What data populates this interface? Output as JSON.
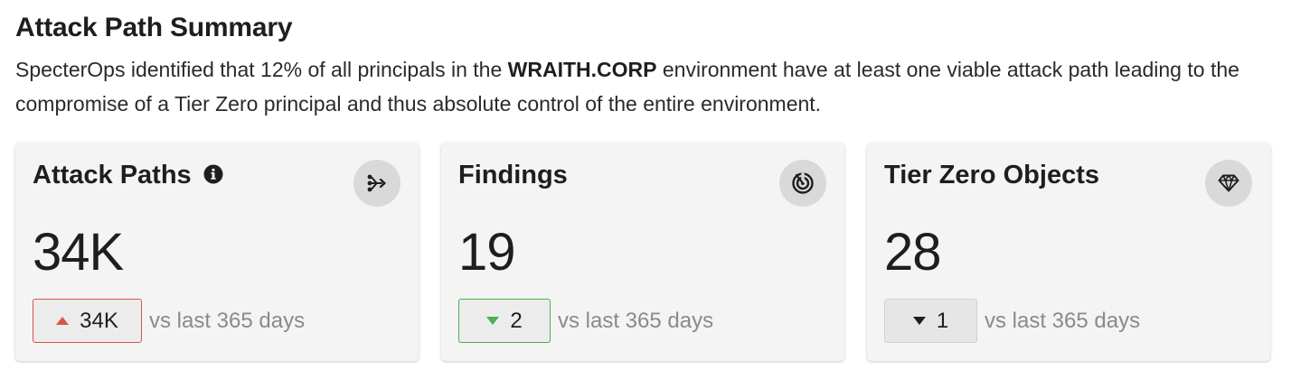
{
  "summary": {
    "title": "Attack Path Summary",
    "desc_prefix": "SpecterOps identified that 12% of all principals in the ",
    "desc_domain": "WRAITH.CORP",
    "desc_suffix": " environment have at least one viable attack path leading to the compromise of a Tier Zero principal and thus absolute control of the entire environment."
  },
  "cards": [
    {
      "title": "Attack Paths",
      "has_info_icon": true,
      "icon": "attack-path-icon",
      "value": "34K",
      "trend": {
        "direction": "up",
        "value": "34K",
        "color": "#d9534f",
        "label": "vs last 365 days"
      }
    },
    {
      "title": "Findings",
      "has_info_icon": false,
      "icon": "radar-icon",
      "value": "19",
      "trend": {
        "direction": "down",
        "value": "2",
        "color": "#4caf50",
        "label": "vs last 365 days"
      }
    },
    {
      "title": "Tier Zero Objects",
      "has_info_icon": false,
      "icon": "gem-icon",
      "value": "28",
      "trend": {
        "direction": "down",
        "value": "1",
        "color": "#1e1e1e",
        "label": "vs last 365 days"
      }
    }
  ]
}
